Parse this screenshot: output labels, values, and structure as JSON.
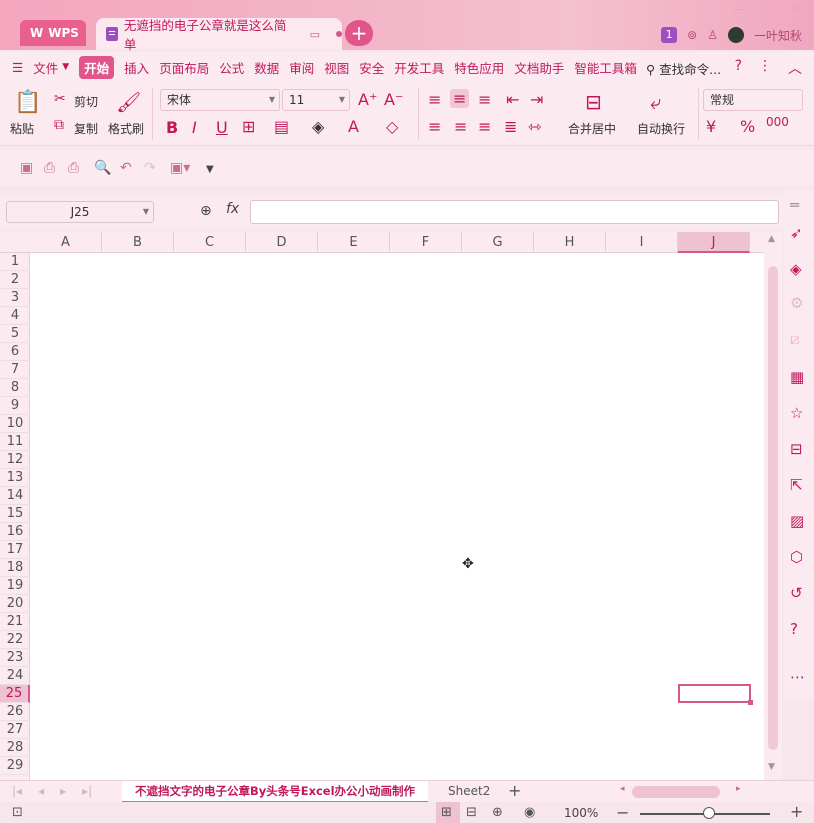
{
  "titlebar": {
    "app_tab": "WPS",
    "doc_tab": "无遮挡的电子公章就是这么简单",
    "badge": "1",
    "user": "一叶知秋",
    "add_icon": "plus-icon"
  },
  "menu": {
    "file": "文件",
    "items": [
      "开始",
      "插入",
      "页面布局",
      "公式",
      "数据",
      "审阅",
      "视图",
      "安全",
      "开发工具",
      "特色应用",
      "文档助手",
      "智能工具箱"
    ],
    "search": "查找命令..."
  },
  "ribbon": {
    "paste": "粘贴",
    "cut": "剪切",
    "copy": "复制",
    "format_painter": "格式刷",
    "font_name": "宋体",
    "font_size": "11",
    "merge_center": "合并居中",
    "wrap_text": "自动换行",
    "number_format": "常规"
  },
  "formula_bar": {
    "name_box": "J25",
    "fx_label": "fx",
    "formula": ""
  },
  "grid": {
    "columns": [
      "A",
      "B",
      "C",
      "D",
      "E",
      "F",
      "G",
      "H",
      "I",
      "J"
    ],
    "rows": [
      "1",
      "2",
      "3",
      "4",
      "5",
      "6",
      "7",
      "8",
      "9",
      "10",
      "11",
      "12",
      "13",
      "14",
      "15",
      "16",
      "17",
      "18",
      "19",
      "20",
      "21",
      "22",
      "23",
      "24",
      "25",
      "26",
      "27",
      "28",
      "29"
    ],
    "selected_column": "J",
    "selected_row": "25"
  },
  "sheets": {
    "active": "不遮挡文字的电子公章By头条号Excel办公小动画制作",
    "other": "Sheet2"
  },
  "status": {
    "zoom": "100%"
  }
}
